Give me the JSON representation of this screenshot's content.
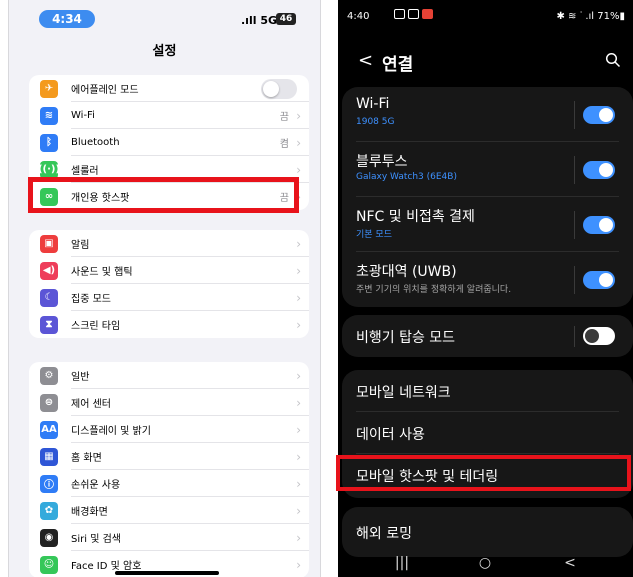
{
  "ios": {
    "status": {
      "time": "4:34",
      "signal": ".ıll 5G",
      "battery": "46"
    },
    "title": "설정",
    "group1": [
      {
        "id": "airplane",
        "label": "에어플레인 모드",
        "value": "",
        "color": "#f49a1e",
        "icon": "airplane-icon",
        "glyph": "✈",
        "toggle": true
      },
      {
        "id": "wifi",
        "label": "Wi-Fi",
        "value": "끔",
        "color": "#2f7cf6",
        "icon": "wifi-icon",
        "glyph": "≋"
      },
      {
        "id": "bluetooth",
        "label": "Bluetooth",
        "value": "켬",
        "color": "#2f7cf6",
        "icon": "bluetooth-icon",
        "glyph": "ᛒ"
      },
      {
        "id": "cellular",
        "label": "셀룰러",
        "value": "",
        "color": "#35c759",
        "icon": "cellular-icon",
        "glyph": "((·))"
      },
      {
        "id": "hotspot",
        "label": "개인용 핫스팟",
        "value": "끔",
        "color": "#35c759",
        "icon": "hotspot-icon",
        "glyph": "∞"
      }
    ],
    "group2": [
      {
        "id": "notifications",
        "label": "알림",
        "color": "#ee3d3d",
        "icon": "notification-icon",
        "glyph": "▣"
      },
      {
        "id": "sounds",
        "label": "사운드 및 햅틱",
        "color": "#ee3d5a",
        "icon": "speaker-icon",
        "glyph": "◀)"
      },
      {
        "id": "focus",
        "label": "집중 모드",
        "color": "#5b55d6",
        "icon": "moon-icon",
        "glyph": "☾"
      },
      {
        "id": "screentime",
        "label": "스크린 타임",
        "color": "#5b55d6",
        "icon": "hourglass-icon",
        "glyph": "⧗"
      }
    ],
    "group3": [
      {
        "id": "general",
        "label": "일반",
        "color": "#8e8e93",
        "icon": "gear-icon",
        "glyph": "⚙"
      },
      {
        "id": "control",
        "label": "제어 센터",
        "color": "#8e8e93",
        "icon": "control-center-icon",
        "glyph": "⊜"
      },
      {
        "id": "display",
        "label": "디스플레이 및 밝기",
        "color": "#2f7cf6",
        "icon": "display-icon",
        "glyph": "AA"
      },
      {
        "id": "home",
        "label": "홈 화면",
        "color": "#2f56d6",
        "icon": "home-grid-icon",
        "glyph": "▦"
      },
      {
        "id": "accessibility",
        "label": "손쉬운 사용",
        "color": "#2f7cf6",
        "icon": "accessibility-icon",
        "glyph": "ⓘ"
      },
      {
        "id": "wallpaper",
        "label": "배경화면",
        "color": "#34aadc",
        "icon": "wallpaper-icon",
        "glyph": "✿"
      },
      {
        "id": "siri",
        "label": "Siri 및 검색",
        "color": "#222222",
        "icon": "siri-icon",
        "glyph": "◉"
      },
      {
        "id": "faceid",
        "label": "Face ID 및 암호",
        "color": "#35c759",
        "icon": "faceid-icon",
        "glyph": "☺"
      }
    ]
  },
  "android": {
    "status": {
      "time": "4:40",
      "right": "✱ ≋ ᐝ .ıl 71%▮"
    },
    "title": "연결",
    "card1": [
      {
        "id": "wifi",
        "label": "Wi-Fi",
        "sub": "1908 5G",
        "sub_style": "blue",
        "toggle": "on"
      },
      {
        "id": "bluetooth",
        "label": "블루투스",
        "sub": "Galaxy Watch3 (6E4B)",
        "sub_style": "blue",
        "toggle": "on"
      },
      {
        "id": "nfc",
        "label": "NFC 및 비접촉 결제",
        "sub": "기본 모드",
        "sub_style": "blue",
        "toggle": "on"
      },
      {
        "id": "uwb",
        "label": "초광대역 (UWB)",
        "sub": "주변 기기의 위치를 정확하게 알려줍니다.",
        "sub_style": "gray",
        "toggle": "on"
      }
    ],
    "card2": [
      {
        "id": "airplane",
        "label": "비행기 탑승 모드",
        "toggle": "off"
      }
    ],
    "card3": [
      {
        "id": "mobile-network",
        "label": "모바일 네트워크"
      },
      {
        "id": "data-usage",
        "label": "데이터 사용"
      },
      {
        "id": "hotspot",
        "label": "모바일 핫스팟 및 테더링"
      }
    ],
    "card4": [
      {
        "id": "roaming",
        "label": "해외 로밍"
      }
    ],
    "nav": {
      "recents": "|||",
      "home": "○",
      "back": "<"
    }
  },
  "colors": {
    "highlight": "#e8131b",
    "android_accent": "#3e91ff",
    "ios_bg": "#f2f2f7"
  }
}
